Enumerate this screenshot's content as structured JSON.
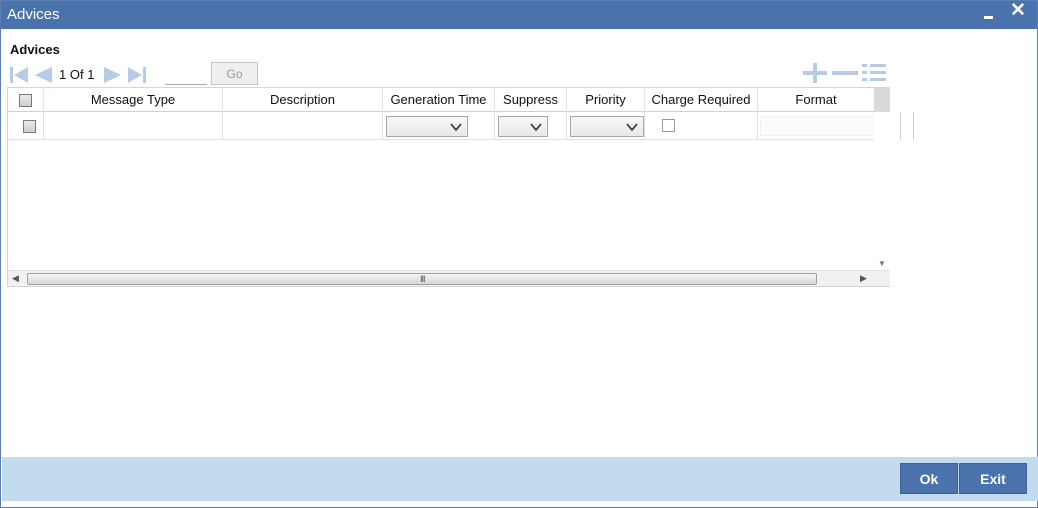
{
  "window": {
    "title": "Advices",
    "minimize_icon": "minimize-icon",
    "close_icon": "close-icon",
    "close_glyph": "✕"
  },
  "section": {
    "title": "Advices"
  },
  "pagination": {
    "current": "1",
    "of_label": "Of",
    "total": "1",
    "page_input": "",
    "go_label": "Go",
    "icons": [
      "first-page-icon",
      "previous-page-icon",
      "next-page-icon",
      "last-page-icon"
    ],
    "row_tools": [
      "add-row-icon",
      "delete-row-icon",
      "single-view-icon"
    ]
  },
  "grid": {
    "columns": [
      "",
      "Message Type",
      "Description",
      "Generation Time",
      "Suppress",
      "Priority",
      "Charge Required",
      "Format"
    ],
    "rows": [
      {
        "selected": false,
        "message_type": "",
        "description": "",
        "generation_time": "",
        "suppress": "",
        "priority": "",
        "charge_required": false,
        "format": ""
      }
    ],
    "scroll_grip": "III"
  },
  "footer": {
    "ok_label": "Ok",
    "exit_label": "Exit"
  },
  "colors": {
    "titlebar": "#4a72ad",
    "footer": "#c3dbef",
    "button": "#4a72ad",
    "nav_icon": "#b7cbe6"
  }
}
